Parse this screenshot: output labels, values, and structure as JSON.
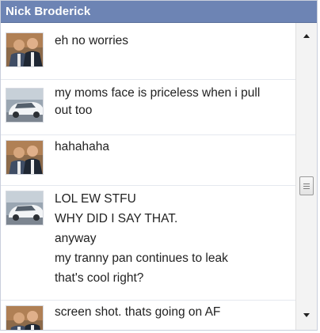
{
  "chat": {
    "title": "Nick Broderick",
    "messages": [
      {
        "avatar": "profile-photo-two-men",
        "lines": [
          "eh no worries"
        ]
      },
      {
        "avatar": "profile-photo-white-car",
        "lines": [
          "my moms face is priceless when i pull",
          "out too"
        ]
      },
      {
        "avatar": "profile-photo-two-men",
        "lines": [
          "hahahaha"
        ]
      },
      {
        "avatar": "profile-photo-white-car",
        "lines": [
          "LOL EW STFU",
          "WHY DID I SAY THAT.",
          "anyway",
          "my tranny pan continues to leak",
          "that's cool right?"
        ]
      },
      {
        "avatar": "profile-photo-two-men",
        "lines": [
          "screen shot. thats going on AF"
        ]
      }
    ]
  },
  "colors": {
    "title_bar": "#6d84b4",
    "title_text": "#ffffff",
    "message_text": "#222222",
    "divider": "#e5e8ef"
  }
}
